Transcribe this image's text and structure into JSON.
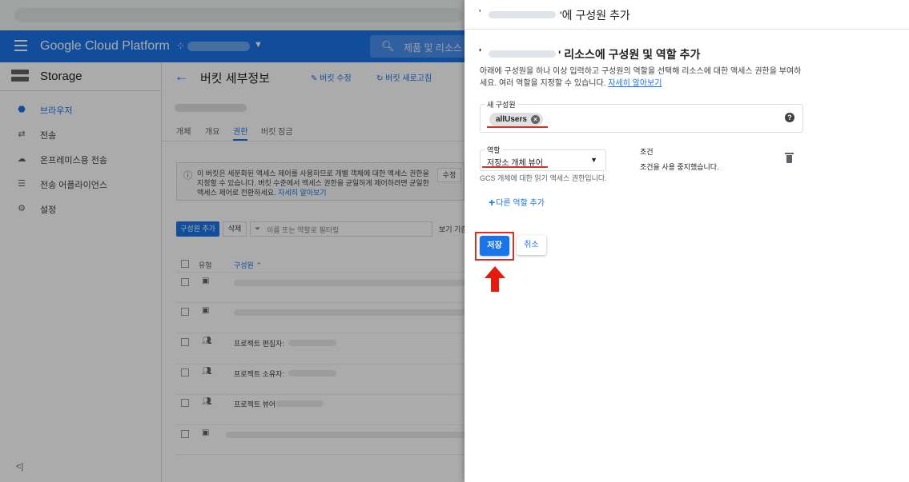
{
  "header": {
    "product": "Google Cloud Platform",
    "search_placeholder": "제품 및 리소스 검"
  },
  "sidebar": {
    "title": "Storage",
    "items": [
      {
        "label": "브라우저",
        "icon": "bucket-icon",
        "active": true
      },
      {
        "label": "전송",
        "icon": "transfer-arrows-icon",
        "active": false
      },
      {
        "label": "온프레미스용 전송",
        "icon": "cloud-upload-icon",
        "active": false
      },
      {
        "label": "전송 어플라이언스",
        "icon": "appliance-icon",
        "active": false
      },
      {
        "label": "설정",
        "icon": "gear-icon",
        "active": false
      }
    ]
  },
  "bucket": {
    "title": "버킷 세부정보",
    "edit_label": "버킷 수정",
    "refresh_label": "버킷 새로고침",
    "tabs": [
      "개체",
      "개요",
      "권한",
      "버킷 잠금"
    ],
    "active_tab": "권한",
    "info_text": "이 버킷은 세분화된 액세스 제어를 사용하므로 개별 객체에 대한 액세스 권한을 지정할 수 있습니다. 버킷 수준에서 액세스 권한을 균일하게 제어하려면 균일한 액세스 제어로 전환하세요.",
    "info_link": "자세히 알아보기",
    "fix_label": "수정",
    "add_member_label": "구성원 추가",
    "delete_label": "삭제",
    "filter_placeholder": "이름 또는 역할로 필터링",
    "view_by_label": "보기 기준",
    "col_type": "유형",
    "col_member": "구성원",
    "rows": [
      {
        "type_icon": "account-icon",
        "text": ""
      },
      {
        "type_icon": "account-icon",
        "text": ""
      },
      {
        "type_icon": "group-icon",
        "text": "프로젝트 편집자:"
      },
      {
        "type_icon": "group-icon",
        "text": "프로젝트 소유자:"
      },
      {
        "type_icon": "group-icon",
        "text": "프로젝트 뷰어"
      },
      {
        "type_icon": "account-icon",
        "text": ""
      }
    ]
  },
  "panel": {
    "title_suffix": "'에 구성원 추가",
    "heading_suffix": "' 리소스에 구성원 및 역할 추가",
    "description": "아래에 구성원을 하나 이상 입력하고 구성원의 역할을 선택해 리소스에 대한 액세스 권한을 부여하세요. 여러 역할을 지정할 수 있습니다.",
    "description_link": "자세히 알아보기",
    "new_member_label": "새 구성원",
    "member_chip": "allUsers",
    "role_label": "역할",
    "role_value": "저장소 개체 뷰어",
    "role_help": "GCS 개체에 대한 읽기 액세스 권한입니다.",
    "condition_title": "조건",
    "condition_text": "조건을 사용 중지했습니다.",
    "add_role_label": "다른 역할 추가",
    "save_label": "저장",
    "cancel_label": "취소"
  },
  "colors": {
    "primary": "#1a73e8",
    "highlight": "#d93025"
  }
}
